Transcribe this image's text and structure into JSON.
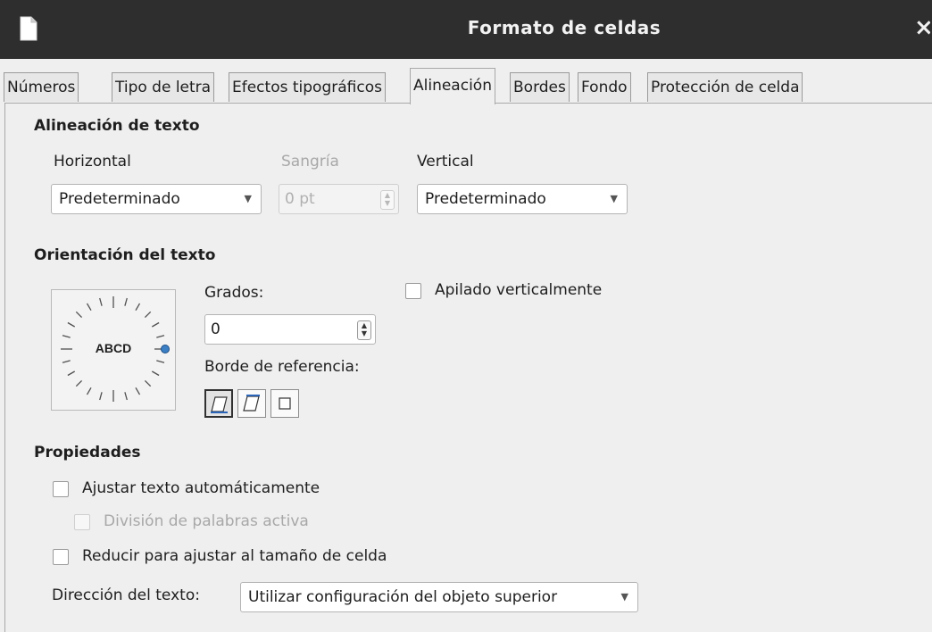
{
  "dialog": {
    "title": "Formato de celdas",
    "close_glyph": "×"
  },
  "tabs": [
    {
      "label": "Números"
    },
    {
      "label": "Tipo de letra"
    },
    {
      "label": "Efectos tipográficos"
    },
    {
      "label": "Alineación"
    },
    {
      "label": "Bordes"
    },
    {
      "label": "Fondo"
    },
    {
      "label": "Protección de celda"
    }
  ],
  "active_tab": "Alineación",
  "alignment": {
    "section_title": "Alineación de texto",
    "horizontal_label": "Horizontal",
    "horizontal_value": "Predeterminado",
    "indent_label": "Sangría",
    "indent_value": "0 pt",
    "vertical_label": "Vertical",
    "vertical_value": "Predeterminado"
  },
  "orientation": {
    "section_title": "Orientación del texto",
    "dial_text": "ABCD",
    "degrees_label": "Grados:",
    "degrees_value": "0",
    "stacked_label": "Apilado verticalmente",
    "stacked_checked": false,
    "reference_edge_label": "Borde de referencia:"
  },
  "properties": {
    "section_title": "Propiedades",
    "wrap_label": "Ajustar texto automáticamente",
    "wrap_checked": false,
    "hyphenation_label": "División de palabras activa",
    "hyphenation_checked": false,
    "shrink_label": "Reducir para ajustar al tamaño de celda",
    "shrink_checked": false,
    "direction_label": "Dirección del texto:",
    "direction_value": "Utilizar configuración del objeto superior"
  },
  "colors": {
    "titlebar": "#2e2e2e",
    "dial_marker": "#3b7fc4",
    "reference_accent": "#2a64b8"
  },
  "icons": {
    "app": "document-icon",
    "close": "close-icon",
    "dropdown": "chevron-down-icon",
    "spin": "spin-arrows-icon",
    "reference": [
      "cell-bottom-edge-icon",
      "cell-top-edge-icon",
      "cell-inside-icon"
    ]
  }
}
